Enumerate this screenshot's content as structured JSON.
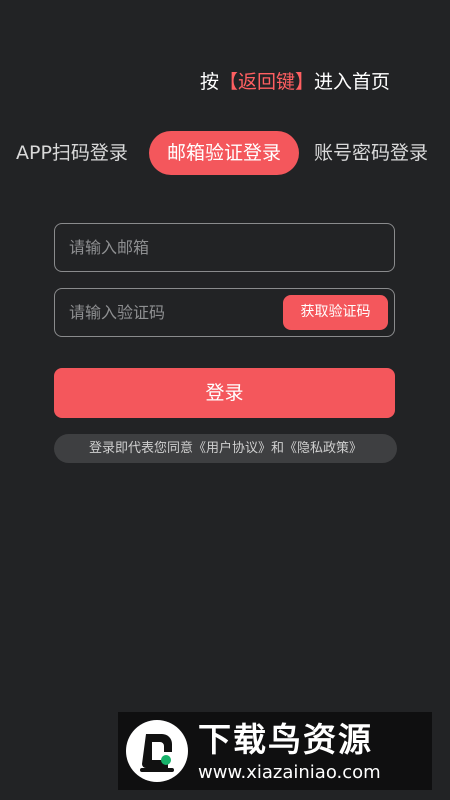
{
  "hint": {
    "prefix": "按",
    "key": "【返回键】",
    "suffix": "进入首页"
  },
  "tabs": [
    {
      "label": "APP扫码登录",
      "active": false
    },
    {
      "label": "邮箱验证登录",
      "active": true
    },
    {
      "label": "账号密码登录",
      "active": false
    }
  ],
  "form": {
    "email_placeholder": "请输入邮箱",
    "code_placeholder": "请输入验证码",
    "get_code_label": "获取验证码",
    "login_label": "登录"
  },
  "agreement": {
    "prefix": "登录即代表您同意",
    "user_agreement": "《用户协议》",
    "and": "和",
    "privacy_policy": "《隐私政策》"
  },
  "watermark": {
    "title": "下载鸟资源",
    "url": "www.xiazainiao.com"
  },
  "colors": {
    "background": "#222325",
    "accent": "#f4575c",
    "field_border": "#8a8b8d",
    "agreement_bg": "#3e3f41"
  }
}
